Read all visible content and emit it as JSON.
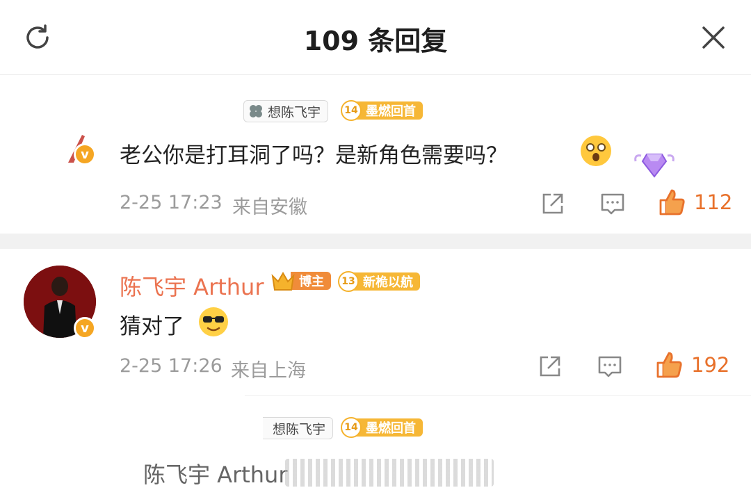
{
  "header": {
    "title": "109 条回复"
  },
  "comments": [
    {
      "user_tag": "想陈飞宇",
      "fan_level": "14",
      "fan_label": "墨燃回首",
      "text": "老公你是打耳洞了吗？是新角色需要吗？",
      "time": "2-25 17:23",
      "location": "来自安徽",
      "likes": "112"
    },
    {
      "name": "陈飞宇 Arthur",
      "role_badge": "博主",
      "fan_level": "13",
      "fan_label": "新桅以航",
      "text": "猜对了",
      "time": "2-25 17:26",
      "location": "来自上海",
      "likes": "192"
    },
    {
      "user_tag": "想陈飞宇",
      "fan_level": "14",
      "fan_label": "墨燃回首",
      "name_partial": "陈飞宇 Arthur"
    }
  ],
  "icons": {
    "refresh": "refresh-icon",
    "close": "close-icon",
    "share": "share-icon",
    "comment": "comment-icon",
    "like": "like-icon",
    "verified": "verified-icon"
  },
  "colors": {
    "accent": "#eb7350",
    "like": "#e8712b",
    "fan_badge": "#f6b736",
    "blogger_badge": "#f08c3a"
  }
}
